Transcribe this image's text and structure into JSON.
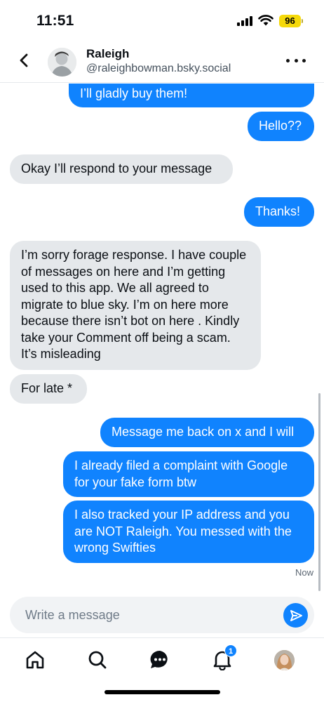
{
  "status_bar": {
    "time": "11:51",
    "battery": "96"
  },
  "header": {
    "name": "Raleigh",
    "handle": "@raleighbowman.bsky.social",
    "back_icon": "chevron-left-icon",
    "more_icon": "ellipsis-icon"
  },
  "messages": [
    {
      "sender": "me",
      "text": "I’ll gladly buy them!"
    },
    {
      "sender": "me",
      "text": "Hello??"
    },
    {
      "sender": "them",
      "text": "Okay I’ll respond to your message"
    },
    {
      "sender": "me",
      "text": "Thanks!"
    },
    {
      "sender": "them",
      "text": "I’m sorry forage response. I have couple of messages on here and I’m getting used to this app. We all agreed to migrate to blue sky. I’m on here more because there isn’t bot on here . Kindly take your Comment off being a scam. It’s misleading"
    },
    {
      "sender": "them",
      "text": "For late *"
    },
    {
      "sender": "me",
      "text": "Message me back on x and I will"
    },
    {
      "sender": "me",
      "text": "I already filed a complaint with Google for your fake form btw"
    },
    {
      "sender": "me",
      "text": "I also tracked your IP address and you are NOT Raleigh. You messed with the wrong Swifties"
    }
  ],
  "last_message_time": "Now",
  "composer": {
    "placeholder": "Write a message",
    "value": "",
    "send_icon": "send-icon"
  },
  "nav": {
    "items": [
      "home-icon",
      "search-icon",
      "chat-icon",
      "bell-icon",
      "profile-avatar"
    ],
    "notification_count": "1"
  },
  "colors": {
    "accent": "#1083fe",
    "incoming_bubble": "#e5e8eb",
    "battery": "#f5d90a"
  }
}
